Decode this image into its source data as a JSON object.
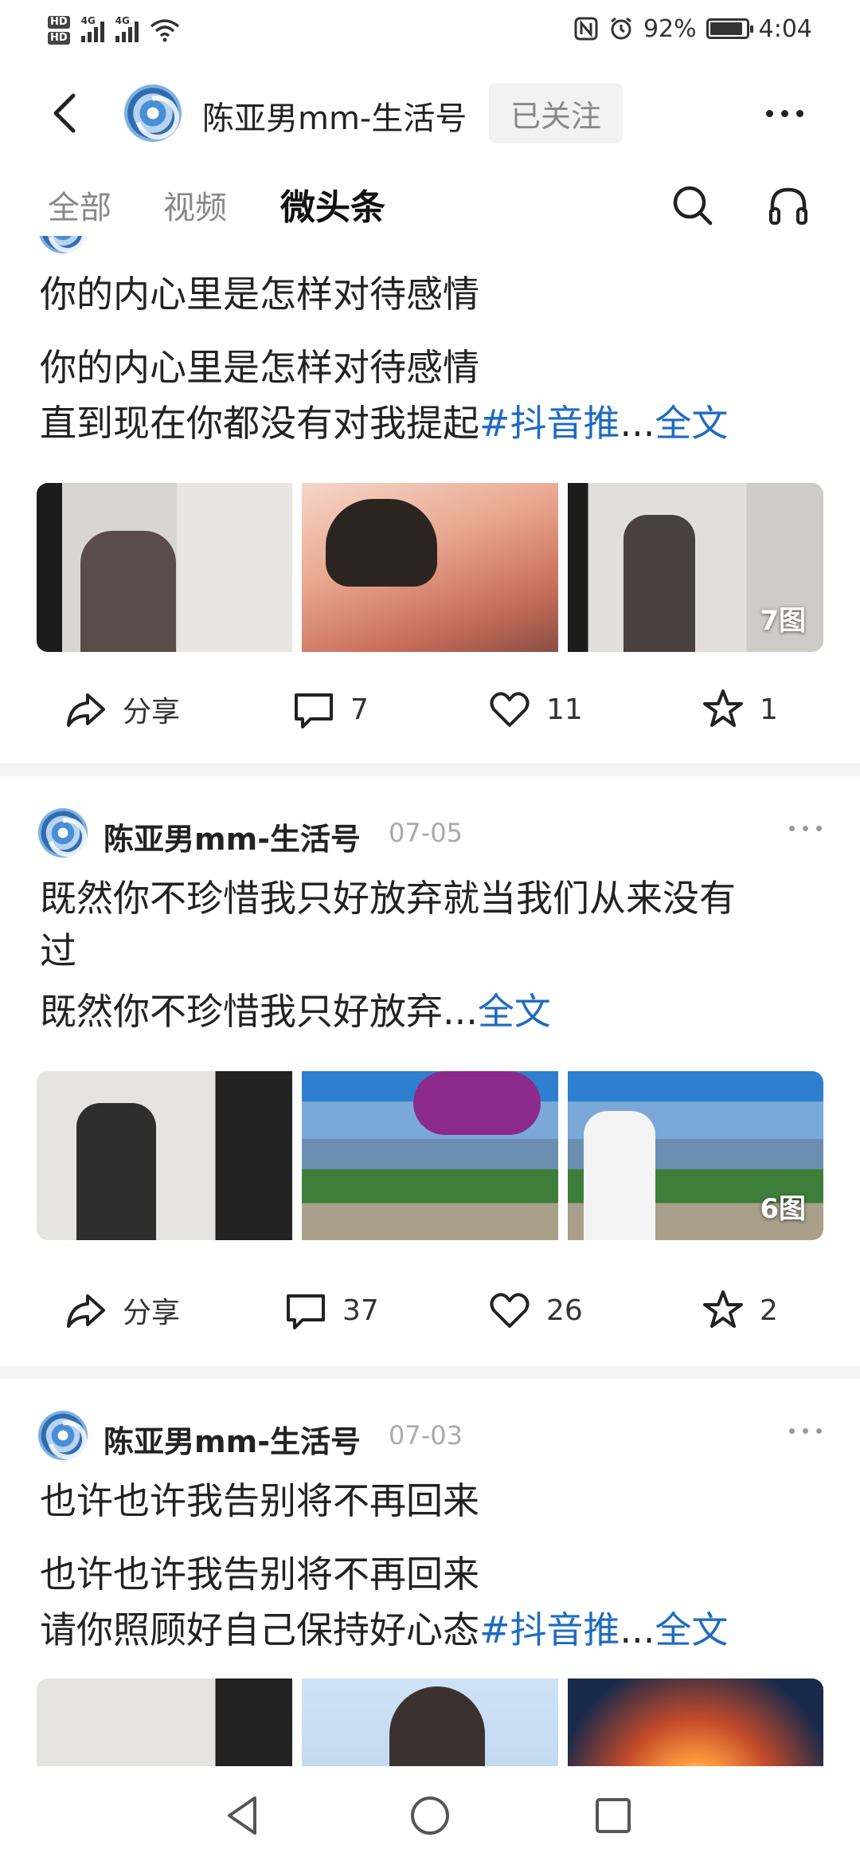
{
  "status_bar": {
    "hd1": "HD",
    "hd2": "HD",
    "net1": "4G",
    "net2": "4G",
    "battery_percent": "92%",
    "battery_level": 0.92,
    "time": "4:04"
  },
  "header": {
    "channel_name": "陈亚男mm-生活号",
    "follow_label": "已关注"
  },
  "tabs": [
    {
      "label": "全部",
      "active": false
    },
    {
      "label": "视频",
      "active": false
    },
    {
      "label": "微头条",
      "active": true
    }
  ],
  "posts": [
    {
      "title": "你的内心里是怎样对待感情",
      "body_lines": [
        "你的内心里是怎样对待感情",
        "直到现在你都没有对我提起"
      ],
      "hashtag": "#抖音推",
      "ellipsis": "...",
      "fulltext_label": "全文",
      "image_count": "7图",
      "actions": {
        "share": "分享",
        "comments": "7",
        "likes": "11",
        "favorites": "1"
      }
    },
    {
      "author": "陈亚男mm-生活号",
      "date": "07-05",
      "title_lines": [
        "既然你不珍惜我只好放弃就当我们从来没有",
        "过"
      ],
      "body_text": "既然你不珍惜我只好放弃",
      "ellipsis": "...",
      "fulltext_label": "全文",
      "image_count": "6图",
      "actions": {
        "share": "分享",
        "comments": "37",
        "likes": "26",
        "favorites": "2"
      }
    },
    {
      "author": "陈亚男mm-生活号",
      "date": "07-03",
      "title": "也许也许我告别将不再回来",
      "body_lines": [
        "也许也许我告别将不再回来",
        "请你照顾好自己保持好心态"
      ],
      "hashtag": "#抖音推",
      "ellipsis": "...",
      "fulltext_label": "全文"
    }
  ],
  "icons": {
    "back": "chevron-left-icon",
    "more": "more-horizontal-icon",
    "search": "search-icon",
    "listen": "headphones-icon",
    "share": "share-icon",
    "comment": "comment-icon",
    "like": "heart-icon",
    "favorite": "star-icon",
    "nav_back": "triangle-back-icon",
    "nav_home": "circle-home-icon",
    "nav_recent": "square-recent-icon"
  },
  "colors": {
    "link": "#1e6bc0",
    "date": "#aaaaaa",
    "follow_bg": "#f2f2f2",
    "divider": "#f3f3f3"
  }
}
